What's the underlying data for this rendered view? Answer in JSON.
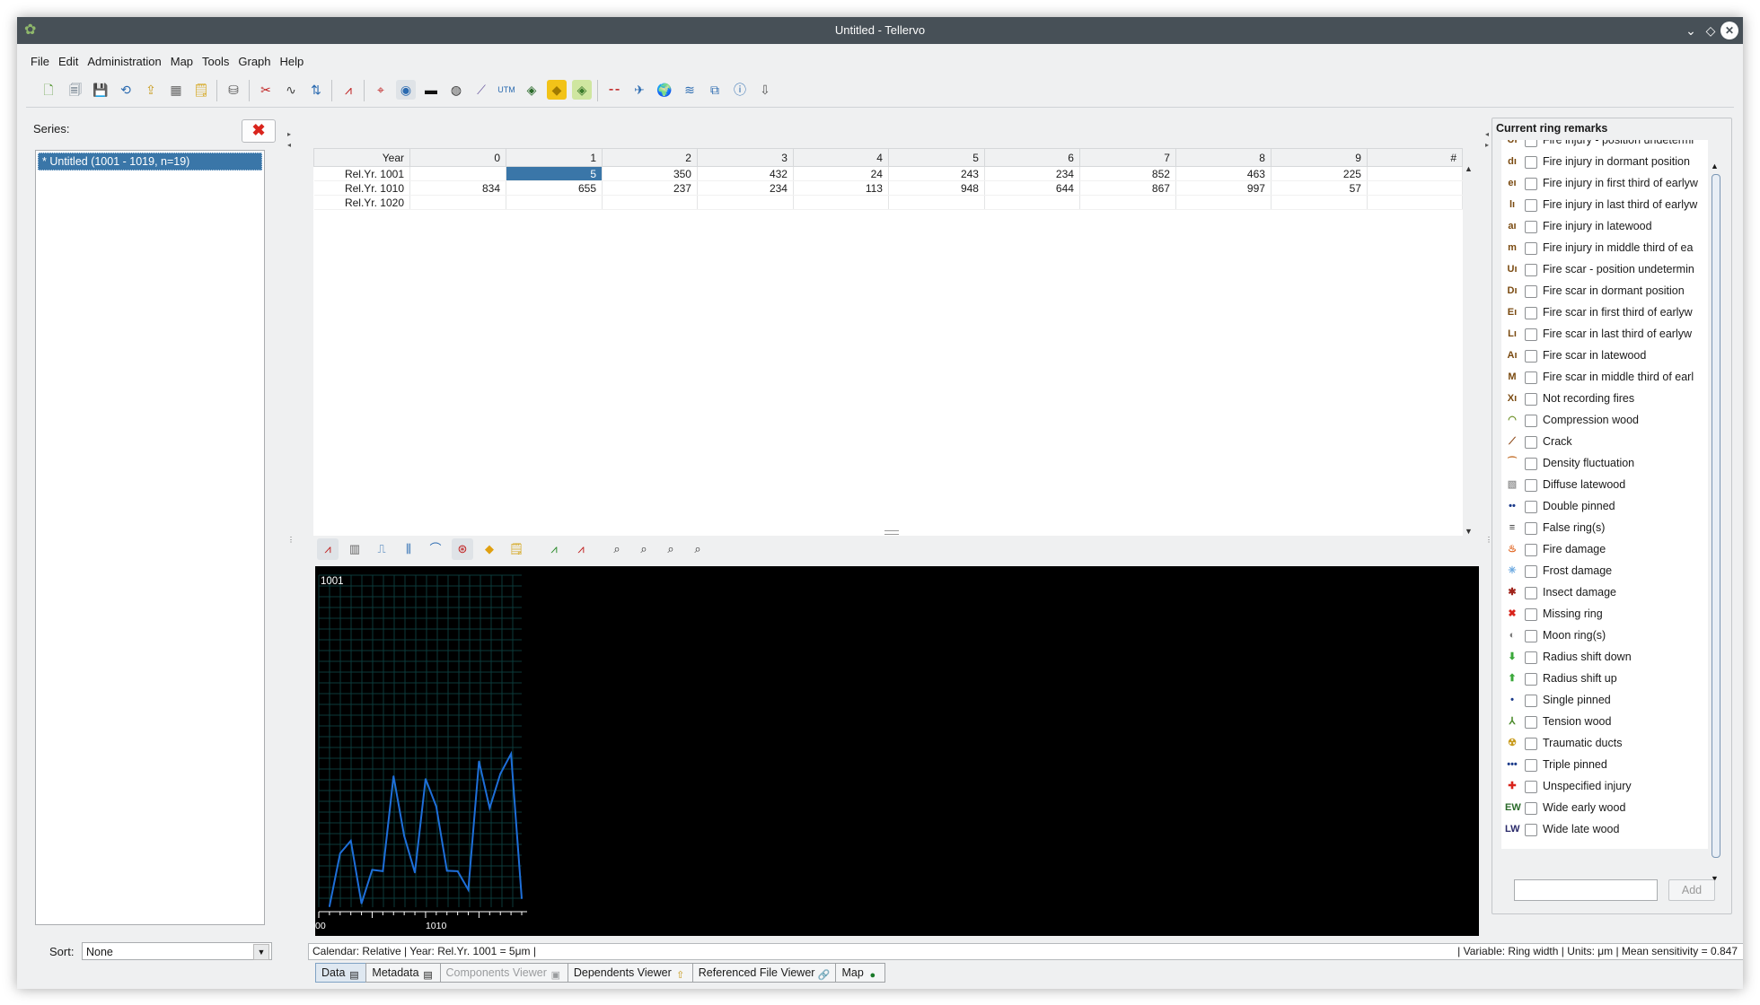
{
  "window": {
    "title": "Untitled - Tellervo"
  },
  "menu": [
    "File",
    "Edit",
    "Administration",
    "Map",
    "Tools",
    "Graph",
    "Help"
  ],
  "toolbar_icons": [
    "new-icon",
    "open-icon",
    "save-icon",
    "refresh-icon",
    "import-icon",
    "series-icon",
    "metadata-icon",
    "database-icon",
    "cut-icon",
    "curve-icon",
    "measure-icon",
    "graph-icon",
    "zoom-icon",
    "target-icon",
    "image-icon",
    "camera-icon",
    "ruler-icon",
    "utm-icon",
    "globe-icon",
    "tag-icon",
    "map-icon",
    "collapse-icon",
    "plane-icon",
    "earth-icon",
    "layers-icon",
    "stack-icon",
    "info-icon",
    "export-icon"
  ],
  "left": {
    "series_label": "Series:",
    "series_items": [
      "* Untitled (1001 - 1019, n=19)"
    ],
    "sort_label": "Sort:",
    "sort_value": "None"
  },
  "table": {
    "header": [
      "Year",
      "0",
      "1",
      "2",
      "3",
      "4",
      "5",
      "6",
      "7",
      "8",
      "9",
      "#"
    ],
    "rows": [
      [
        "Rel.Yr. 1001",
        "",
        "5",
        "350",
        "432",
        "24",
        "243",
        "234",
        "852",
        "463",
        "225",
        ""
      ],
      [
        "Rel.Yr. 1010",
        "834",
        "655",
        "237",
        "234",
        "113",
        "948",
        "644",
        "867",
        "997",
        "57",
        ""
      ],
      [
        "Rel.Yr. 1020",
        "",
        "",
        "",
        "",
        "",
        "",
        "",
        "",
        "",
        "",
        ""
      ]
    ]
  },
  "chart_data": {
    "type": "line",
    "title": "1001",
    "x_tick_labels": [
      "00",
      "1010"
    ],
    "x": [
      1001,
      1002,
      1003,
      1004,
      1005,
      1006,
      1007,
      1008,
      1009,
      1010,
      1011,
      1012,
      1013,
      1014,
      1015,
      1016,
      1017,
      1018,
      1019
    ],
    "values": [
      5,
      350,
      432,
      24,
      243,
      234,
      852,
      463,
      225,
      834,
      655,
      237,
      234,
      113,
      948,
      644,
      867,
      997,
      57
    ],
    "xlim": [
      1000,
      1019
    ],
    "ylim": [
      0,
      2100
    ],
    "colors": {
      "line": "#1e6fd9",
      "grid": "#0b3a3a",
      "background": "#000000"
    }
  },
  "status": {
    "left": "Calendar: Relative   |   Year: Rel.Yr. 1001 = 5μm   |",
    "right": "|   Variable: Ring width   |   Units: μm   |   Mean sensitivity = 0.847"
  },
  "tabs": [
    {
      "label": "Data",
      "icon": "table-icon",
      "active": true
    },
    {
      "label": "Metadata",
      "icon": "metadata-icon",
      "active": false
    },
    {
      "label": "Components Viewer",
      "icon": "components-icon",
      "disabled": true
    },
    {
      "label": "Dependents Viewer",
      "icon": "dependents-icon"
    },
    {
      "label": "Referenced File Viewer",
      "icon": "link-icon"
    },
    {
      "label": "Map",
      "icon": "globe-icon"
    }
  ],
  "remarks": {
    "title": "Current ring remarks",
    "add_label": "Add",
    "input_value": "",
    "items": [
      {
        "label": "Fire injury - position undetermi",
        "icon": "Uı",
        "color": "#7a4a10"
      },
      {
        "label": "Fire injury in dormant position",
        "icon": "dı",
        "color": "#7a4a10"
      },
      {
        "label": "Fire injury in first third of earlyw",
        "icon": "eı",
        "color": "#7a4a10"
      },
      {
        "label": "Fire injury in last third of earlyw",
        "icon": "lı",
        "color": "#7a4a10"
      },
      {
        "label": "Fire injury in latewood",
        "icon": "aı",
        "color": "#7a4a10"
      },
      {
        "label": "Fire injury in middle third of ea",
        "icon": "m",
        "color": "#7a4a10"
      },
      {
        "label": "Fire scar - position undetermin",
        "icon": "Uı",
        "color": "#7a4a10"
      },
      {
        "label": "Fire scar in dormant position",
        "icon": "Dı",
        "color": "#7a4a10"
      },
      {
        "label": "Fire scar in first third of earlyw",
        "icon": "Eı",
        "color": "#7a4a10"
      },
      {
        "label": "Fire scar in last third of earlyw",
        "icon": "Lı",
        "color": "#7a4a10"
      },
      {
        "label": "Fire scar in latewood",
        "icon": "Aı",
        "color": "#7a4a10"
      },
      {
        "label": "Fire scar in middle third of earl",
        "icon": "M",
        "color": "#7a4a10"
      },
      {
        "label": "Not recording fires",
        "icon": "Xı",
        "color": "#7a4a10"
      },
      {
        "label": "Compression wood",
        "icon": "◠",
        "color": "#6b8e23"
      },
      {
        "label": "Crack",
        "icon": "⟋",
        "color": "#8b4513"
      },
      {
        "label": "Density fluctuation",
        "icon": "⁀",
        "color": "#c87a3a"
      },
      {
        "label": "Diffuse latewood",
        "icon": "▧",
        "color": "#999999"
      },
      {
        "label": "Double pinned",
        "icon": "••",
        "color": "#1a3a8a"
      },
      {
        "label": "False ring(s)",
        "icon": "≡",
        "color": "#333333"
      },
      {
        "label": "Fire damage",
        "icon": "♨",
        "color": "#e0601a"
      },
      {
        "label": "Frost damage",
        "icon": "✳",
        "color": "#6aa8e0"
      },
      {
        "label": "Insect damage",
        "icon": "✱",
        "color": "#a0241c"
      },
      {
        "label": "Missing ring",
        "icon": "✖",
        "color": "#d9241c"
      },
      {
        "label": "Moon ring(s)",
        "icon": "◐",
        "color": "#777777"
      },
      {
        "label": "Radius shift down",
        "icon": "⬇",
        "color": "#3aa83a"
      },
      {
        "label": "Radius shift up",
        "icon": "⬆",
        "color": "#3aa83a"
      },
      {
        "label": "Single pinned",
        "icon": "•",
        "color": "#1a3a8a"
      },
      {
        "label": "Tension wood",
        "icon": "⅄",
        "color": "#4a8a2a"
      },
      {
        "label": "Traumatic ducts",
        "icon": "☢",
        "color": "#c89a1a"
      },
      {
        "label": "Triple pinned",
        "icon": "•••",
        "color": "#1a3a8a"
      },
      {
        "label": "Unspecified injury",
        "icon": "✚",
        "color": "#d9241c"
      },
      {
        "label": "Wide early wood",
        "icon": "EW",
        "color": "#2a6a2a"
      },
      {
        "label": "Wide late wood",
        "icon": "LW",
        "color": "#2a2a6a"
      }
    ]
  }
}
